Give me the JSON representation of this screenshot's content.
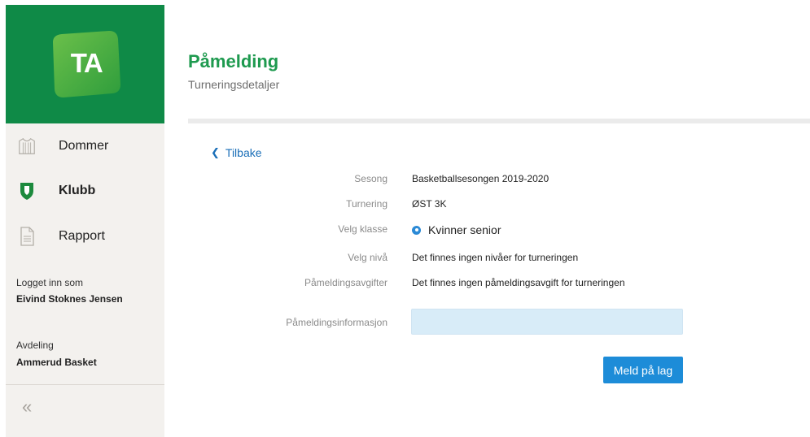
{
  "brand": {
    "logo_text": "TA",
    "color": "#0f8a47"
  },
  "sidebar": {
    "items": [
      {
        "label": "Dommer",
        "icon": "jersey-icon",
        "active": false
      },
      {
        "label": "Klubb",
        "icon": "shield-icon",
        "active": true
      },
      {
        "label": "Rapport",
        "icon": "document-icon",
        "active": false
      }
    ],
    "logged_in_label": "Logget inn som",
    "logged_in_user": "Eivind Stoknes Jensen",
    "department_label": "Avdeling",
    "department_value": "Ammerud Basket",
    "collapse_glyph": "«"
  },
  "header": {
    "title": "Påmelding",
    "subtitle": "Turneringsdetaljer",
    "title_color": "#1e9a4f"
  },
  "back": {
    "label": "Tilbake"
  },
  "details": {
    "season_label": "Sesong",
    "season_value": "Basketballsesongen 2019-2020",
    "tournament_label": "Turnering",
    "tournament_value": "ØST 3K",
    "class_label": "Velg klasse",
    "class_option": "Kvinner senior",
    "level_label": "Velg nivå",
    "level_value": "Det finnes ingen nivåer for turneringen",
    "fee_label": "Påmeldingsavgifter",
    "fee_value": "Det finnes ingen påmeldingsavgift for turneringen",
    "info_label": "Påmeldingsinformasjon",
    "info_value": ""
  },
  "actions": {
    "submit_label": "Meld på lag",
    "accent": "#1d8cd8"
  }
}
